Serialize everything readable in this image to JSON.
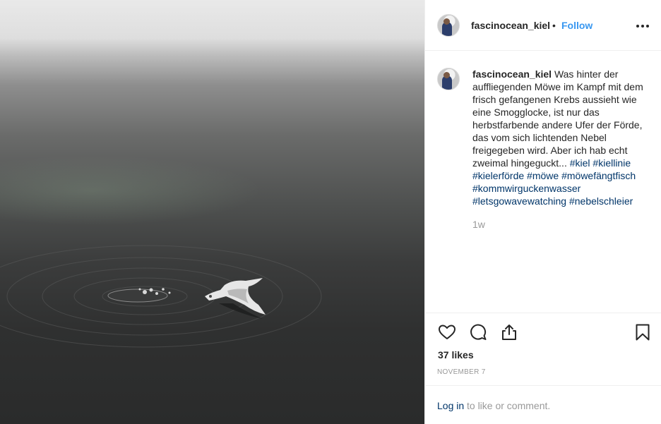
{
  "post": {
    "username": "fascinocean_kiel",
    "separator": "•",
    "follow_label": "Follow",
    "more_icon": "more-options-icon",
    "photo_description_icon": "post-photo"
  },
  "caption": {
    "username": "fascinocean_kiel",
    "text": "Was hinter der auffliegenden Möwe im Kampf mit dem frisch gefangenen Krebs aussieht wie eine Smogglocke, ist nur das herbstfarbende andere Ufer der Förde, das vom sich lichtenden Nebel freigegeben wird. Aber ich hab echt zweimal hingeguckt...",
    "hashtags": [
      "#kiel",
      "#kiellinie",
      "#kielerförde",
      "#möwe",
      "#möwefängtfisch",
      "#kommwirguckenwasser",
      "#letsgowavewatching",
      "#nebelschleier"
    ],
    "time_ago": "1w"
  },
  "actions": {
    "like_icon": "heart-icon",
    "comment_icon": "comment-icon",
    "share_icon": "share-icon",
    "save_icon": "bookmark-icon"
  },
  "likes_text": "37 likes",
  "date_text": "NOVEMBER 7",
  "footer": {
    "login_label": "Log in",
    "login_suffix": "to like or comment."
  },
  "colors": {
    "link_blue": "#3897f0",
    "hashtag_blue": "#003569",
    "text": "#262626",
    "muted": "#999999"
  }
}
